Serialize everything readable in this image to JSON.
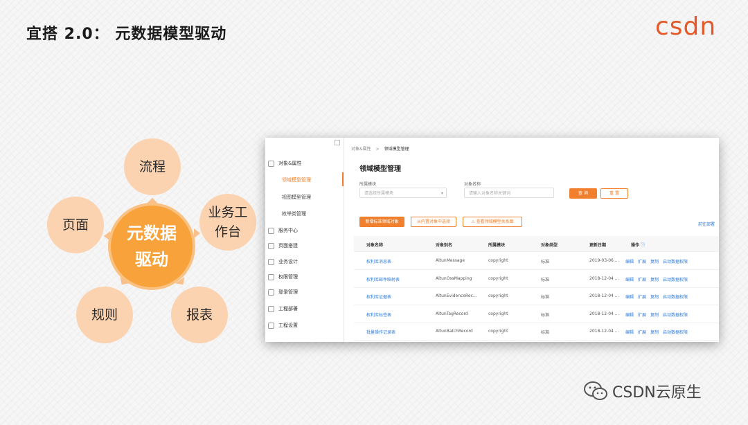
{
  "slide": {
    "title": "宜搭 2.0： 元数据模型驱动",
    "logo": "CSDN",
    "watermark": "CSDN云原生"
  },
  "diagram": {
    "center": "元数据驱动",
    "nodes": [
      "流程",
      "业务工作台",
      "报表",
      "规则",
      "页面"
    ],
    "colors": {
      "center": "#f7a23a",
      "node": "#fbd3b0",
      "arrow": "#f9c08b"
    }
  },
  "app": {
    "sidebar": {
      "groups": [
        {
          "label": "对象&属性",
          "icon": "settings-icon"
        },
        {
          "label": "服务中心",
          "icon": "monitor-icon"
        },
        {
          "label": "页面搭建",
          "icon": "page-icon"
        },
        {
          "label": "业务设计",
          "icon": "briefcase-icon"
        },
        {
          "label": "权限管理",
          "icon": "lock-icon"
        },
        {
          "label": "登录管理",
          "icon": "login-icon"
        },
        {
          "label": "工程部署",
          "icon": "deploy-icon"
        },
        {
          "label": "工程设置",
          "icon": "gear-icon"
        }
      ],
      "sub_items": [
        "领域模型管理",
        "视图模型管理",
        "枚举类管理"
      ]
    },
    "breadcrumb": {
      "parent": "对象&属性",
      "sep": ">",
      "current": "领域模型管理"
    },
    "page_title": "领域模型管理",
    "filters": {
      "module_label": "所属模块",
      "module_placeholder": "请选择所属模块",
      "name_label": "对象名称",
      "name_placeholder": "请输入对象名称关键词",
      "query": "查 询",
      "reset": "重 置"
    },
    "actions": {
      "add": "新增标准领域对象",
      "select_builtin": "从内置对象中选择",
      "view_relations": "查看领域模型关系图",
      "goto_deploy": "前往部署"
    },
    "table": {
      "headers": [
        "对象名称",
        "对象别名",
        "所属模块",
        "对象类型",
        "更新日期",
        "操作"
      ],
      "rows": [
        {
          "name": "权利库消息表",
          "alias": "AltunMessage",
          "module": "copyright",
          "type": "标准",
          "date": "2019-03-06 ..."
        },
        {
          "name": "权利库邮件映射表",
          "alias": "AltunOssMapping",
          "module": "copyright",
          "type": "标准",
          "date": "2018-12-04 ..."
        },
        {
          "name": "权利库证据表",
          "alias": "AltunEvidenceRec...",
          "module": "copyright",
          "type": "标准",
          "date": "2018-12-04 ..."
        },
        {
          "name": "权利库标签表",
          "alias": "AltunTagRecord",
          "module": "copyright",
          "type": "标准",
          "date": "2018-12-04 ..."
        },
        {
          "name": "批量操作记录表",
          "alias": "AltunBatchRecord",
          "module": "copyright",
          "type": "标准",
          "date": "2018-12-04 ..."
        }
      ],
      "ops": [
        "编辑",
        "扩展",
        "复制",
        "启动数据权限"
      ]
    }
  }
}
